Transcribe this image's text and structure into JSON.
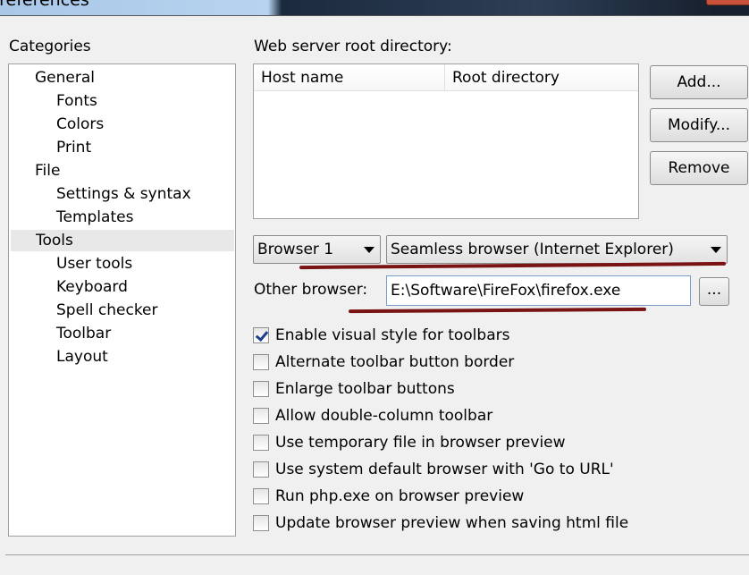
{
  "window": {
    "title": "Preferences"
  },
  "categories": {
    "label": "Categories",
    "items": [
      {
        "label": "General",
        "level": 0
      },
      {
        "label": "Fonts",
        "level": 1
      },
      {
        "label": "Colors",
        "level": 1
      },
      {
        "label": "Print",
        "level": 1
      },
      {
        "label": "File",
        "level": 0
      },
      {
        "label": "Settings & syntax",
        "level": 1
      },
      {
        "label": "Templates",
        "level": 1
      },
      {
        "label": "Tools",
        "level": 0,
        "selected": true
      },
      {
        "label": "User tools",
        "level": 1
      },
      {
        "label": "Keyboard",
        "level": 1
      },
      {
        "label": "Spell checker",
        "level": 1
      },
      {
        "label": "Toolbar",
        "level": 1
      },
      {
        "label": "Layout",
        "level": 1
      }
    ]
  },
  "webserver": {
    "label": "Web server root directory:",
    "columns": [
      "Host name",
      "Root directory"
    ],
    "rows": [],
    "buttons": {
      "add": "Add...",
      "modify": "Modify...",
      "remove": "Remove"
    }
  },
  "browser": {
    "slot": "Browser 1",
    "type": "Seamless browser (Internet Explorer)",
    "other_label": "Other browser:",
    "other_value": "E:\\Software\\FireFox\\firefox.exe",
    "browse_label": "..."
  },
  "options": [
    {
      "label": "Enable visual style for toolbars",
      "checked": true
    },
    {
      "label": "Alternate toolbar button border",
      "checked": false
    },
    {
      "label": "Enlarge toolbar buttons",
      "checked": false
    },
    {
      "label": "Allow double-column toolbar",
      "checked": false
    },
    {
      "label": "Use temporary file in browser preview",
      "checked": false
    },
    {
      "label": "Use system default browser with 'Go to URL'",
      "checked": false
    },
    {
      "label": "Run php.exe on browser preview",
      "checked": false
    },
    {
      "label": "Update browser preview when saving html file",
      "checked": false
    }
  ],
  "colors": {
    "annotation": "#7a1414",
    "check": "#1c3f8c"
  }
}
